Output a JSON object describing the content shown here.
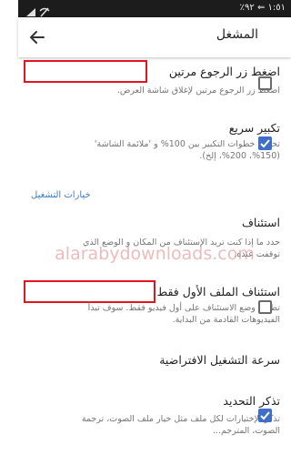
{
  "status_bar": {
    "text": "١:٥١ ⇐ ٩٢٪"
  },
  "toolbar": {
    "title": "المشغل"
  },
  "settings": [
    {
      "title": "اضغط زر الرجوع مرتين",
      "subtitle": "اضغط زر الرجوع مرتين لإغلاق شاشة العرض.",
      "checked": false
    },
    {
      "title": "تكبير سريع",
      "subtitle": "تخطي خطوات التكبير بين 100% و 'ملائمة الشاشة' (150%، 200%، إلخ).",
      "checked": true
    },
    {
      "section": "خيارات التشغيل"
    },
    {
      "title": "استئناف",
      "subtitle": "حدد ما إذا كنت تريد الإستئناف من المكان و الوضع الذي توقفت عنده."
    },
    {
      "title": "استئناف الملف الأول فقط",
      "subtitle": "تطبيق وضع الاستئناف على أول فيديو فقط. سوف تبدأ الفيديوهات القادمة من البداية.",
      "checked": false
    },
    {
      "title": "سرعة التشغيل الافتراضية"
    },
    {
      "title": "تذكر التحديد",
      "subtitle": "تذكر الإختيارات لكل ملف مثل خيار ملف الصوت، ترجمة الصوت، المترجم...",
      "checked": true
    }
  ],
  "watermark": "alarabydownloads.com",
  "colors": {
    "accent": "#3f6ec8",
    "link": "#3d7cc9",
    "highlight": "#e3161d",
    "statusbar": "#1c1c1c"
  }
}
